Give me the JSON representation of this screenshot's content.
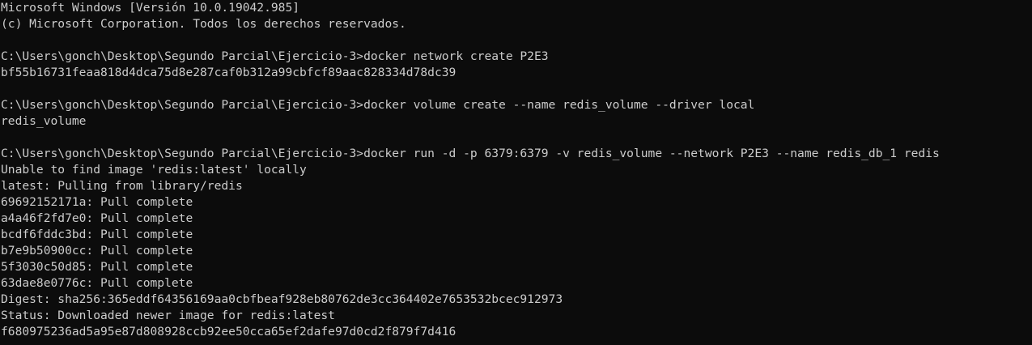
{
  "terminal": {
    "lines": [
      "Microsoft Windows [Versión 10.0.19042.985]",
      "(c) Microsoft Corporation. Todos los derechos reservados.",
      "",
      "C:\\Users\\gonch\\Desktop\\Segundo Parcial\\Ejercicio-3>docker network create P2E3",
      "bf55b16731feaa818d4dca75d8e287caf0b312a99cbfcf89aac828334d78dc39",
      "",
      "C:\\Users\\gonch\\Desktop\\Segundo Parcial\\Ejercicio-3>docker volume create --name redis_volume --driver local",
      "redis_volume",
      "",
      "C:\\Users\\gonch\\Desktop\\Segundo Parcial\\Ejercicio-3>docker run -d -p 6379:6379 -v redis_volume --network P2E3 --name redis_db_1 redis",
      "Unable to find image 'redis:latest' locally",
      "latest: Pulling from library/redis",
      "69692152171a: Pull complete",
      "a4a46f2fd7e0: Pull complete",
      "bcdf6fddc3bd: Pull complete",
      "b7e9b50900cc: Pull complete",
      "5f3030c50d85: Pull complete",
      "63dae8e0776c: Pull complete",
      "Digest: sha256:365eddf64356169aa0cbfbeaf928eb80762de3cc364402e7653532bcec912973",
      "Status: Downloaded newer image for redis:latest",
      "f680975236ad5a95e87d808928ccb92ee50cca65ef2dafe97d0cd2f879f7d416"
    ]
  },
  "colors": {
    "background": "#0c0c0c",
    "foreground": "#cccccc"
  }
}
